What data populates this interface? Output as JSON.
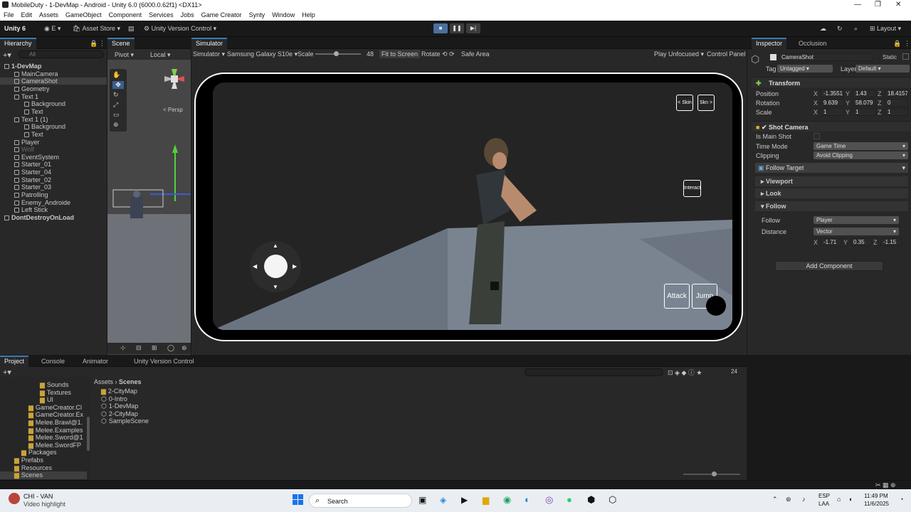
{
  "window": {
    "title": "MobileDuty - 1-DevMap - Android - Unity 6.0 (6000.0.62f1) <DX11>"
  },
  "menu": [
    "File",
    "Edit",
    "Assets",
    "GameObject",
    "Component",
    "Services",
    "Jobs",
    "Game Creator",
    "Synty",
    "Window",
    "Help"
  ],
  "toolbar": {
    "unity": "Unity 6",
    "account": "E",
    "asset_store": "Asset Store",
    "version_control": "Unity Version Control",
    "layout": "Layout"
  },
  "hierarchy": {
    "tab": "Hierarchy",
    "search_placeholder": "All",
    "items": [
      {
        "label": "1-DevMap",
        "depth": 0
      },
      {
        "label": "MainCamera",
        "depth": 1
      },
      {
        "label": "CameraShot",
        "depth": 1
      },
      {
        "label": "Geometry",
        "depth": 1
      },
      {
        "label": "Text 1",
        "depth": 1
      },
      {
        "label": "Background",
        "depth": 2
      },
      {
        "label": "Text",
        "depth": 2
      },
      {
        "label": "Text 1 (1)",
        "depth": 1
      },
      {
        "label": "Background",
        "depth": 2
      },
      {
        "label": "Text",
        "depth": 2
      },
      {
        "label": "Player",
        "depth": 1
      },
      {
        "label": "Wolf",
        "depth": 1
      },
      {
        "label": "EventSystem",
        "depth": 1
      },
      {
        "label": "Starter_01",
        "depth": 1
      },
      {
        "label": "Starter_04",
        "depth": 1
      },
      {
        "label": "Starter_02",
        "depth": 1
      },
      {
        "label": "Starter_03",
        "depth": 1
      },
      {
        "label": "Patrolling",
        "depth": 1
      },
      {
        "label": "Enemy_Androide",
        "depth": 1
      },
      {
        "label": "Left Stick",
        "depth": 1
      },
      {
        "label": "DontDestroyOnLoad",
        "depth": 0
      }
    ]
  },
  "scene": {
    "tab": "Scene",
    "pivot": "Pivot",
    "local": "Local",
    "persp": "< Persp"
  },
  "simulator": {
    "tab": "Simulator",
    "mode": "Simulator",
    "device": "Samsung Galaxy S10e",
    "scale_label": "Scale",
    "scale_value": "48",
    "fit": "Fit to Screen",
    "rotate": "Rotate",
    "safe_area": "Safe Area",
    "play_mode": "Play Unfocused",
    "control_panel": "Control Panel"
  },
  "game": {
    "skin_prev": "< Skin",
    "skin_next": "Skn >",
    "interact": "Interact",
    "attack": "Attack",
    "jump": "Jump"
  },
  "inspector": {
    "tab": "Inspector",
    "tab2": "Occlusion",
    "object": "CameraShot",
    "static": "Static",
    "tag_label": "Tag",
    "tag": "Untagged",
    "layer_label": "Layer",
    "layer": "Default",
    "transform": "Transform",
    "position_label": "Position",
    "rotation_label": "Rotation",
    "scale_label": "Scale",
    "pos": [
      "-1.3551",
      "1.43",
      "18.4157"
    ],
    "rot": [
      "9.639",
      "58.079",
      "0"
    ],
    "scl": [
      "1",
      "1",
      "1"
    ],
    "shot_camera": "Shot Camera",
    "is_main": "Is Main Shot",
    "time_mode_label": "Time Mode",
    "time_mode": "Game Time",
    "clipping_label": "Clipping",
    "clipping": "Avoid Clipping",
    "follow_target": "Follow Target",
    "viewport": "Viewport",
    "look": "Look",
    "follow": "Follow",
    "follow_label": "Follow",
    "follow_value": "Player",
    "distance_label": "Distance",
    "distance_value": "Vector",
    "dist": [
      "-1.71",
      "0.35",
      "-1.15"
    ],
    "add_component": "Add Component"
  },
  "bottom": {
    "tabs": [
      "Project",
      "Console",
      "Animator",
      "Unity Version Control"
    ],
    "breadcrumb1": "Assets",
    "breadcrumb2": "Scenes",
    "count": "24",
    "tree": [
      "Sounds",
      "Textures",
      "UI",
      "GameCreator.Cl",
      "GameCreator.Ex",
      "Melee.Brawl@1.",
      "Melee.Examples",
      "Melee.Sword@1",
      "Melee.SwordFP",
      "Packages",
      "Prefabs",
      "Resources",
      "Scenes"
    ],
    "files": [
      "2-CityMap",
      "0-Intro",
      "1-DevMap",
      "2-CityMap",
      "SampleScene"
    ]
  },
  "taskbar": {
    "notif_title": "CHI - VAN",
    "notif_sub": "Video highlight",
    "search": "Search",
    "lang1": "ESP",
    "lang2": "LAA",
    "time": "11:49 PM",
    "date": "11/6/2025"
  }
}
